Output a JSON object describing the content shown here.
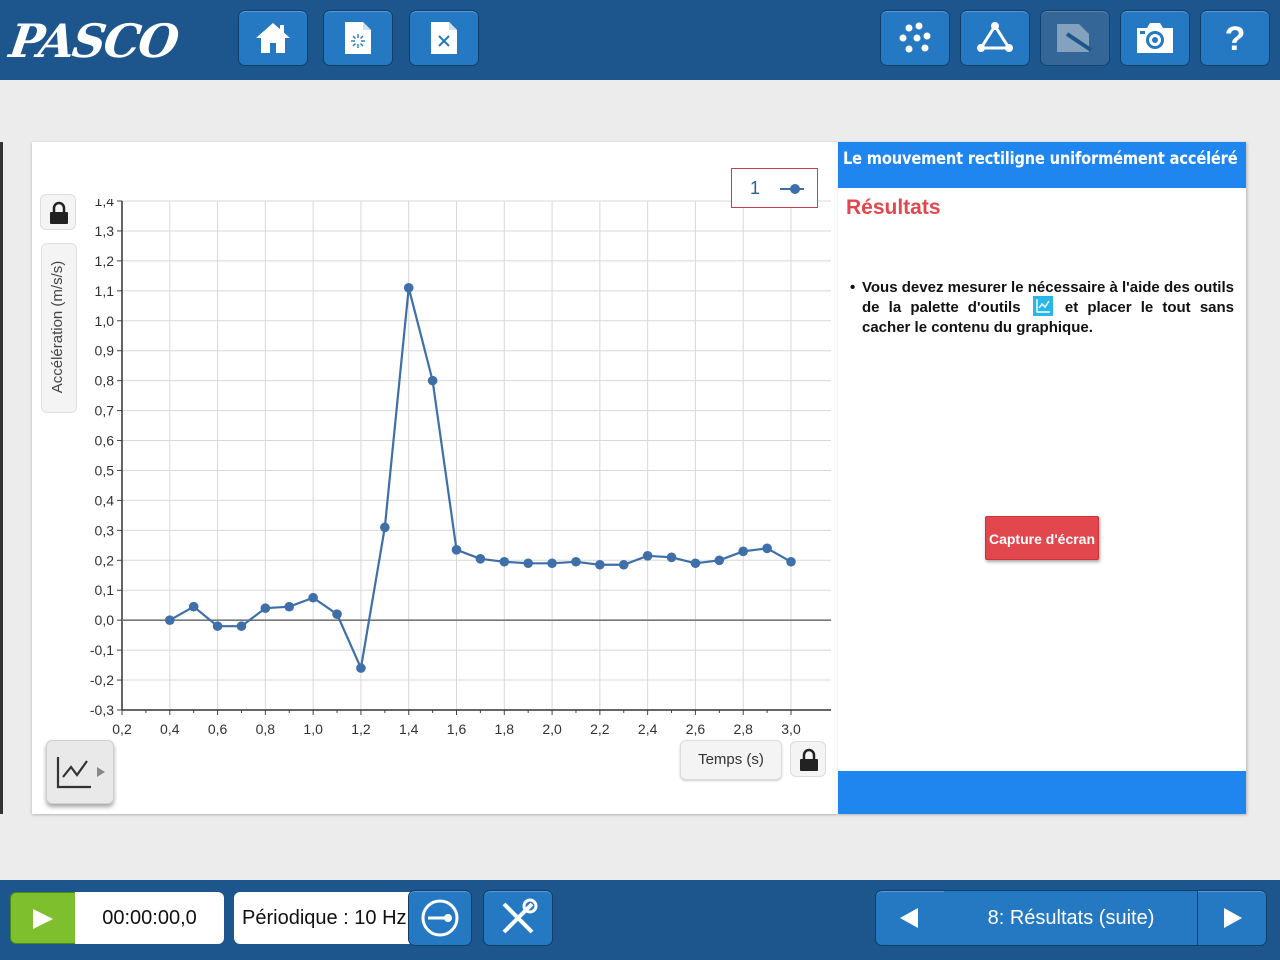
{
  "app": {
    "logo_text": "PASCO"
  },
  "toolbar": {
    "left_buttons": [
      {
        "name": "home-icon"
      },
      {
        "name": "new-file-icon"
      },
      {
        "name": "close-file-icon"
      }
    ],
    "right_buttons": [
      {
        "name": "scatter-icon"
      },
      {
        "name": "triangle-graph-icon"
      },
      {
        "name": "annotation-icon",
        "disabled": true
      },
      {
        "name": "camera-icon"
      },
      {
        "name": "help-icon",
        "label": "?"
      }
    ]
  },
  "graph": {
    "run_legend": "1",
    "x_axis_label": "Temps (s)",
    "y_axis_label": "Accélération (m/s/s)"
  },
  "chart_data": {
    "type": "line",
    "xlabel": "Temps (s)",
    "ylabel": "Accélération (m/s/s)",
    "xlim": [
      0.2,
      3.0
    ],
    "ylim": [
      -0.3,
      1.4
    ],
    "x_ticks": [
      "0,2",
      "0,4",
      "0,6",
      "0,8",
      "1,0",
      "1,2",
      "1,4",
      "1,6",
      "1,8",
      "2,0",
      "2,2",
      "2,4",
      "2,6",
      "2,8",
      "3,0"
    ],
    "y_ticks": [
      "-0,3",
      "-0,2",
      "-0,1",
      "0,0",
      "0,1",
      "0,2",
      "0,3",
      "0,4",
      "0,5",
      "0,6",
      "0,7",
      "0,8",
      "0,9",
      "1,0",
      "1,1",
      "1,2",
      "1,3",
      "1,4"
    ],
    "grid": true,
    "series": [
      {
        "color": "#3e6fa8",
        "x": [
          0.4,
          0.5,
          0.6,
          0.7,
          0.8,
          0.9,
          1.0,
          1.1,
          1.2,
          1.3,
          1.4,
          1.5,
          1.6,
          1.7,
          1.8,
          1.9,
          2.0,
          2.1,
          2.2,
          2.3,
          2.4,
          2.5,
          2.6,
          2.7,
          2.8,
          2.9,
          3.0
        ],
        "values": [
          0.0,
          0.045,
          -0.02,
          -0.02,
          0.04,
          0.045,
          0.075,
          0.02,
          -0.16,
          0.31,
          1.11,
          0.8,
          0.235,
          0.205,
          0.195,
          0.19,
          0.19,
          0.195,
          0.185,
          0.185,
          0.215,
          0.21,
          0.19,
          0.2,
          0.23,
          0.24,
          0.195
        ]
      }
    ]
  },
  "right_panel": {
    "title": "Le mouvement rectiligne uniformément accéléré",
    "subtitle": "Résultats",
    "bullet": "•",
    "instruction_part1": "Vous devez mesurer le nécessaire à l'aide des outils de la palette d'outils",
    "instruction_part2": "et placer le tout sans cacher le contenu du graphique.",
    "capture_button": "Capture d'écran",
    "header_color": "#1f86f0",
    "accent_color": "#e1474c"
  },
  "bottom_bar": {
    "timer": "00:00:00,0",
    "sampling_mode": "Périodique : 10 Hz",
    "page_label": "8: Résultats (suite)"
  }
}
